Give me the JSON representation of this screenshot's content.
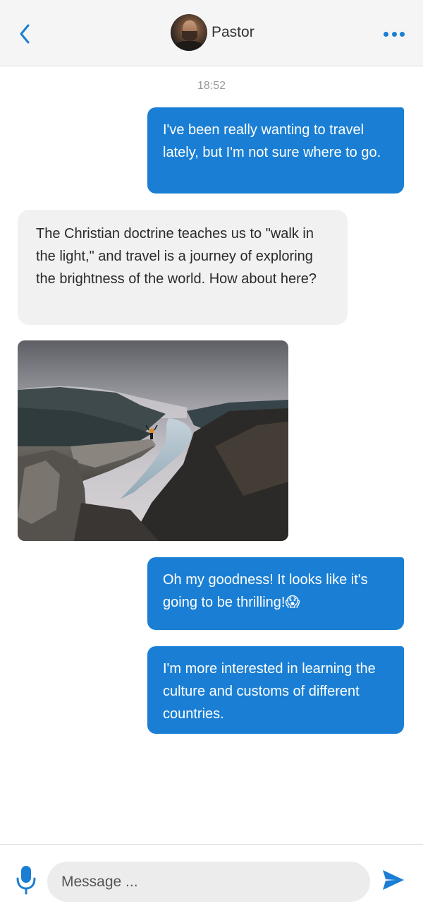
{
  "header": {
    "contact_name": "Pastor",
    "back_icon": "chevron-left-icon",
    "more_icon": "more-horizontal-icon"
  },
  "conversation": {
    "timestamp": "18:52",
    "messages": [
      {
        "direction": "outgoing",
        "text": "I've been really wanting to travel lately, but I'm not sure where to go."
      },
      {
        "direction": "incoming",
        "text": "The Christian doctrine teaches us to \"walk in the light,\" and travel is a journey of exploring the brightness of the world. How about here?"
      },
      {
        "direction": "incoming",
        "type": "image",
        "content": "fjord-cliff-photo"
      },
      {
        "direction": "outgoing",
        "text": "Oh my goodness! It looks like it's going to be thrilling!😱"
      },
      {
        "direction": "outgoing",
        "text": "I'm more interested in learning the culture and customs of different countries."
      }
    ]
  },
  "composer": {
    "placeholder": "Message ...",
    "value": "",
    "mic_icon": "microphone-icon",
    "send_icon": "send-icon"
  },
  "colors": {
    "accent": "#1a7fd4",
    "outgoing_bubble": "#1a7fd4",
    "incoming_bubble": "#f1f1f2",
    "header_bg": "#f5f5f5"
  }
}
